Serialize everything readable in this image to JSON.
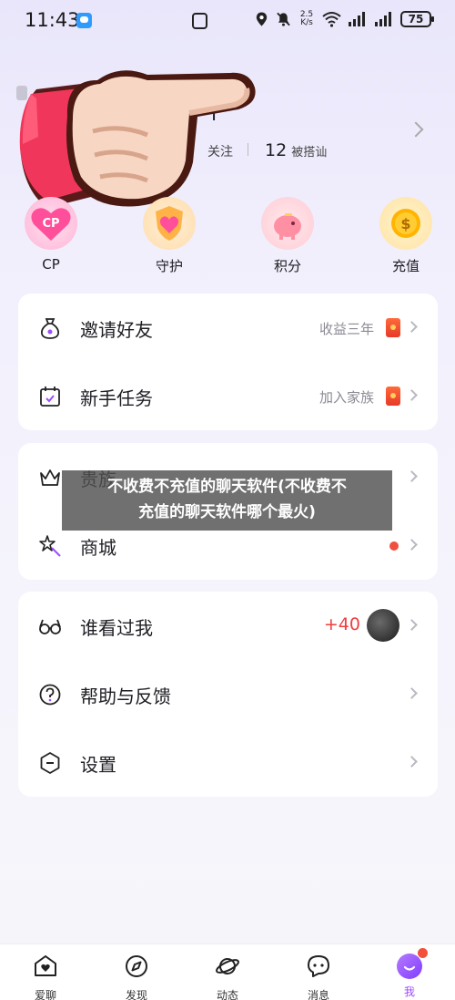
{
  "status_bar": {
    "time": "11:43",
    "speed_top": "2.5",
    "speed_bottom": "K/s",
    "battery": "75"
  },
  "profile": {
    "name_tail": "ı",
    "following_label": "关注",
    "followed_count": "12",
    "followed_label": "被搭讪"
  },
  "quick_actions": [
    {
      "label": "CP",
      "icon": "cp-heart-icon",
      "badge": "CP",
      "color": "#ff5fa8"
    },
    {
      "label": "守护",
      "icon": "guard-shield-icon",
      "color": "#ffb347"
    },
    {
      "label": "积分",
      "icon": "piggy-bank-icon",
      "color": "#ff8fa3"
    },
    {
      "label": "充值",
      "icon": "coin-icon",
      "badge": "$",
      "color": "#ffb400"
    }
  ],
  "menu_card_1": {
    "items": [
      {
        "label": "邀请好友",
        "right_text": "收益三年",
        "icon": "money-bag-icon"
      },
      {
        "label": "新手任务",
        "right_text": "加入家族",
        "icon": "calendar-task-icon"
      }
    ]
  },
  "menu_card_2": {
    "items": [
      {
        "label": "贵族",
        "icon": "crown-icon"
      },
      {
        "label": "商城",
        "icon": "magic-wand-icon"
      }
    ]
  },
  "menu_card_3": {
    "items": [
      {
        "label": "谁看过我",
        "right_text": "+40",
        "icon": "glasses-icon"
      },
      {
        "label": "帮助与反馈",
        "icon": "help-icon"
      },
      {
        "label": "设置",
        "icon": "settings-icon"
      }
    ]
  },
  "overlay": {
    "line1": "不收费不充值的聊天软件(不收费不",
    "line2": "充值的聊天软件哪个最火)"
  },
  "bottom_nav": [
    {
      "label": "爱聊",
      "icon": "home-heart-icon"
    },
    {
      "label": "发现",
      "icon": "compass-icon"
    },
    {
      "label": "动态",
      "icon": "planet-icon"
    },
    {
      "label": "消息",
      "icon": "chat-bubble-icon"
    },
    {
      "label": "我",
      "icon": "me-smile-icon",
      "active": true
    }
  ],
  "colors": {
    "accent": "#9b4dff",
    "red": "#ef3e3e",
    "hand_red": "#f0365a"
  }
}
